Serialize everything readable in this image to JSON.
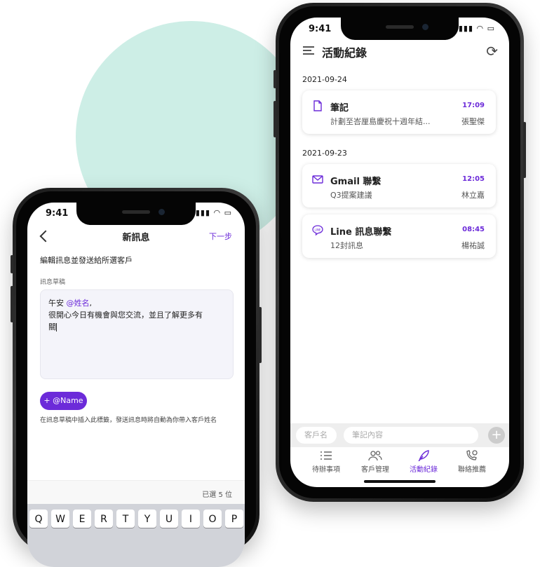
{
  "left_phone": {
    "status_time": "9:41",
    "header": {
      "title": "新訊息",
      "next_label": "下一步"
    },
    "instruction": "編輯訊息並發送給所選客戶",
    "draft_label": "訊息草稿",
    "draft": {
      "greeting": "午安",
      "mention": "@姓名",
      "comma": ",",
      "line2": "很開心今日有機會與您交流，並且了解更多有",
      "line3": "關"
    },
    "name_button": "+ @Name",
    "hint": "在訊息草稿中插入此標籤，發送訊息時將自動為你帶入客戶姓名",
    "selected_count": "已選 5 位",
    "keyboard_keys": [
      "Q",
      "W",
      "E",
      "R",
      "T",
      "Y",
      "U",
      "I",
      "O",
      "P"
    ]
  },
  "right_phone": {
    "status_time": "9:41",
    "header": {
      "title": "活動紀錄"
    },
    "groups": [
      {
        "date": "2021-09-24",
        "items": [
          {
            "icon": "note-icon",
            "title": "筆記",
            "time": "17:09",
            "subtitle": "計劃至峇厘島慶祝十週年結...",
            "name": "張聖傑"
          }
        ]
      },
      {
        "date": "2021-09-23",
        "items": [
          {
            "icon": "mail-icon",
            "title": "Gmail 聯繫",
            "time": "12:05",
            "subtitle": "Q3提案建議",
            "name": "林立嘉"
          },
          {
            "icon": "line-icon",
            "title": "Line 訊息聯繫",
            "time": "08:45",
            "subtitle": "12封訊息",
            "name": "楊祐誠"
          }
        ]
      }
    ],
    "input_bar": {
      "client_placeholder": "客戶名",
      "note_placeholder": "筆記內容",
      "add": "+"
    },
    "tabs": [
      {
        "label": "待辦事項",
        "icon": "list-icon"
      },
      {
        "label": "客戶管理",
        "icon": "users-icon"
      },
      {
        "label": "活動紀錄",
        "icon": "feather-icon",
        "active": true
      },
      {
        "label": "聯絡推薦",
        "icon": "phone-icon"
      }
    ]
  },
  "colors": {
    "accent": "#6c2bd9",
    "blob": "#cdeee6"
  }
}
